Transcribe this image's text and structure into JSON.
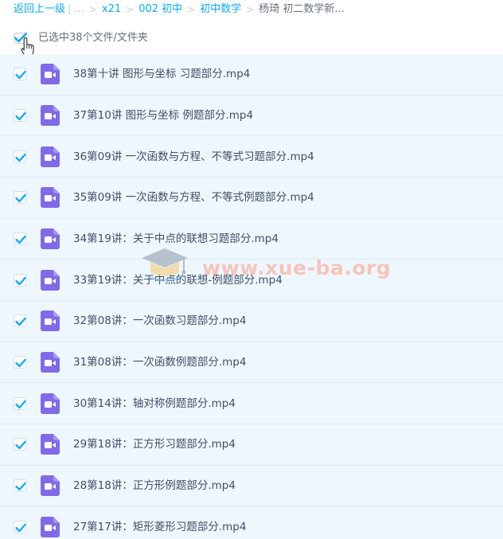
{
  "breadcrumb": {
    "back": "返回上一级",
    "ellipsis": "...",
    "items": [
      "x21",
      "002 初中",
      "初中数学"
    ],
    "current": "杨琦 初二数学新..."
  },
  "selection": {
    "checked": true,
    "text": "已选中38个文件/文件夹"
  },
  "files": [
    {
      "name": "38第十讲 图形与坐标 习题部分.mp4",
      "checked": true
    },
    {
      "name": "37第10讲 图形与坐标 例题部分.mp4",
      "checked": true
    },
    {
      "name": "36第09讲 一次函数与方程、不等式习题部分.mp4",
      "checked": true
    },
    {
      "name": "35第09讲 一次函数与方程、不等式例题部分.mp4",
      "checked": true
    },
    {
      "name": "34第19讲：关于中点的联想习题部分.mp4",
      "checked": true
    },
    {
      "name": "33第19讲：关于中点的联想-例题部分.mp4",
      "checked": true
    },
    {
      "name": "32第08讲：一次函数习题部分.mp4",
      "checked": true
    },
    {
      "name": "31第08讲：一次函数例题部分.mp4",
      "checked": true
    },
    {
      "name": "30第14讲：轴对称例题部分.mp4",
      "checked": true
    },
    {
      "name": "29第18讲：正方形习题部分.mp4",
      "checked": true
    },
    {
      "name": "28第18讲：正方形例题部分.mp4",
      "checked": true
    },
    {
      "name": "27第17讲：矩形菱形习题部分.mp4",
      "checked": true
    }
  ],
  "icons": {
    "file_type": "video-file-icon",
    "check": "checkmark-icon",
    "cursor": "hand-pointer-icon"
  },
  "watermark": {
    "text": "www.xue-ba.org"
  },
  "colors": {
    "link": "#09aaff",
    "row_bg": "#eef7fe",
    "row_border": "#dfeaf5",
    "check": "#09aaff",
    "video_icon": "#7f6ae8",
    "text": "#424e67",
    "watermark": "#ff9b82"
  }
}
